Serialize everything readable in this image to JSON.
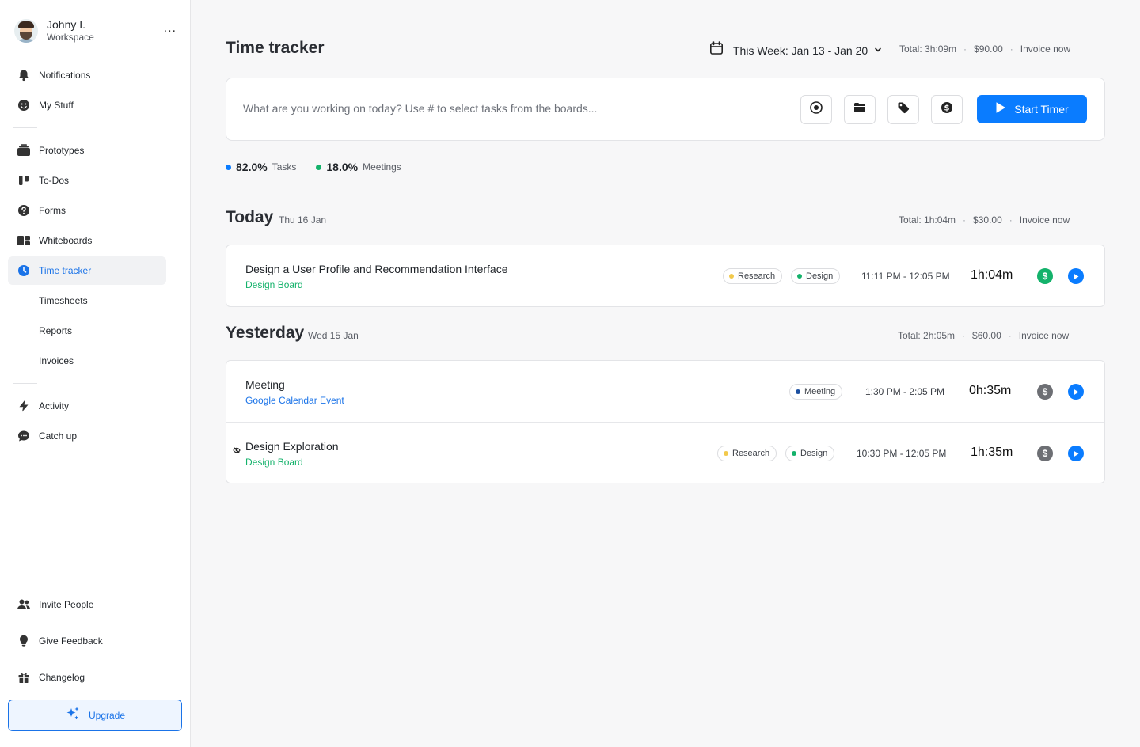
{
  "user": {
    "name": "Johny I.",
    "workspace": "Workspace",
    "more": "..."
  },
  "nav": {
    "notifications": "Notifications",
    "my_stuff": "My Stuff",
    "prototypes": "Prototypes",
    "todos": "To-Dos",
    "forms": "Forms",
    "whiteboards": "Whiteboards",
    "time_tracker": "Time tracker",
    "timesheets": "Timesheets",
    "reports": "Reports",
    "invoices": "Invoices",
    "activity": "Activity",
    "catch_up": "Catch up",
    "invite_people": "Invite People",
    "give_feedback": "Give Feedback",
    "changelog": "Changelog",
    "upgrade": "Upgrade"
  },
  "header": {
    "title": "Time tracker",
    "week_label": "This Week: Jan 13 - Jan 20",
    "total": "Total: 3h:09m",
    "amount": "$90.00",
    "invoice": "Invoice now",
    "separator": "·"
  },
  "timer": {
    "placeholder": "What are you working on today? Use # to select tasks from the boards...",
    "value": "",
    "start_label": "Start Timer"
  },
  "stats": [
    {
      "pct": "82.0%",
      "label": "Tasks",
      "color": "#0a7cff"
    },
    {
      "pct": "18.0%",
      "label": "Meetings",
      "color": "#14b26b"
    }
  ],
  "today": {
    "title": "Today",
    "date": "Thu 16 Jan",
    "total": "Total: 1h:04m",
    "amount": "$30.00",
    "invoice": "Invoice now",
    "entries": [
      {
        "title": "Design a User Profile and Recommendation Interface",
        "board": "Design Board",
        "tags": [
          "Research",
          "Design"
        ],
        "range": "11:11 PM - 12:05 PM",
        "duration": "1h:04m",
        "billable": true
      }
    ]
  },
  "yesterday": {
    "title": "Yesterday",
    "date": "Wed 15 Jan",
    "total": "Total: 2h:05m",
    "amount": "$60.00",
    "invoice": "Invoice now",
    "entries": [
      {
        "title": "Meeting",
        "board": "Google Calendar Event",
        "tags": [
          "Meeting"
        ],
        "range": "1:30 PM - 2:05 PM",
        "duration": "0h:35m",
        "billable": false
      },
      {
        "title": "Design Exploration",
        "board": "Design Board",
        "tags": [
          "Research",
          "Design"
        ],
        "range": "10:30 PM - 12:05 PM",
        "duration": "1h:35m",
        "billable": false
      }
    ]
  },
  "colors": {
    "accent": "#0a7cff",
    "green": "#14b26b",
    "tag_research": "#f2c94c",
    "tag_design": "#14b26b",
    "tag_meeting": "#1b4fa0",
    "money_off": "#6d6f74"
  }
}
